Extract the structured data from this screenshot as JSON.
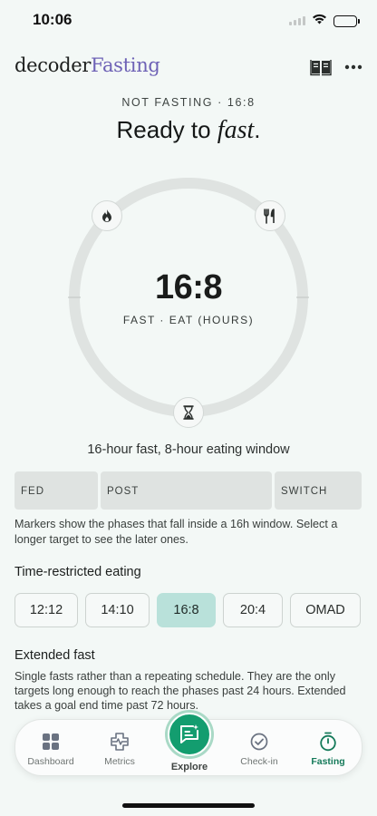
{
  "status_bar": {
    "time": "10:06"
  },
  "header": {
    "brand_primary": "decoder",
    "brand_secondary": "Fasting",
    "book_icon": "book-icon",
    "more_icon": "more-icon"
  },
  "status": {
    "caption": "NOT FASTING · 16:8",
    "headline_prefix": "Ready to ",
    "headline_emphasis": "fast",
    "headline_suffix": "."
  },
  "dial": {
    "ratio": "16:8",
    "subtitle": "FAST · EAT (HOURS)",
    "markers": [
      "flame-icon",
      "fork-knife-icon",
      "hourglass-icon"
    ]
  },
  "window_description": "16-hour fast, 8-hour eating window",
  "phases": [
    {
      "label": "FED"
    },
    {
      "label": "POST"
    },
    {
      "label": "SWITCH"
    }
  ],
  "phase_note": "Markers show the phases that fall inside a 16h window. Select a longer target to see the later ones.",
  "time_restricted": {
    "title": "Time-restricted eating",
    "options": [
      "12:12",
      "14:10",
      "16:8",
      "20:4",
      "OMAD"
    ],
    "selected": "16:8"
  },
  "extended": {
    "title": "Extended fast",
    "note": "Single fasts rather than a repeating schedule. They are the only targets long enough to reach the phases past 24 hours. Extended takes a goal end time past 72 hours."
  },
  "tabs": [
    {
      "label": "Dashboard",
      "icon": "grid-icon"
    },
    {
      "label": "Metrics",
      "icon": "metrics-icon"
    },
    {
      "label": "Explore",
      "icon": "chat-sparkle-icon"
    },
    {
      "label": "Check-in",
      "icon": "check-circle-icon"
    },
    {
      "label": "Fasting",
      "icon": "stopwatch-icon"
    }
  ],
  "active_tab": "Fasting",
  "colors": {
    "accent": "#139d6f",
    "brand_purple": "#6e62b6",
    "selected_chip": "#b9e1da",
    "background": "#f3f8f6"
  }
}
